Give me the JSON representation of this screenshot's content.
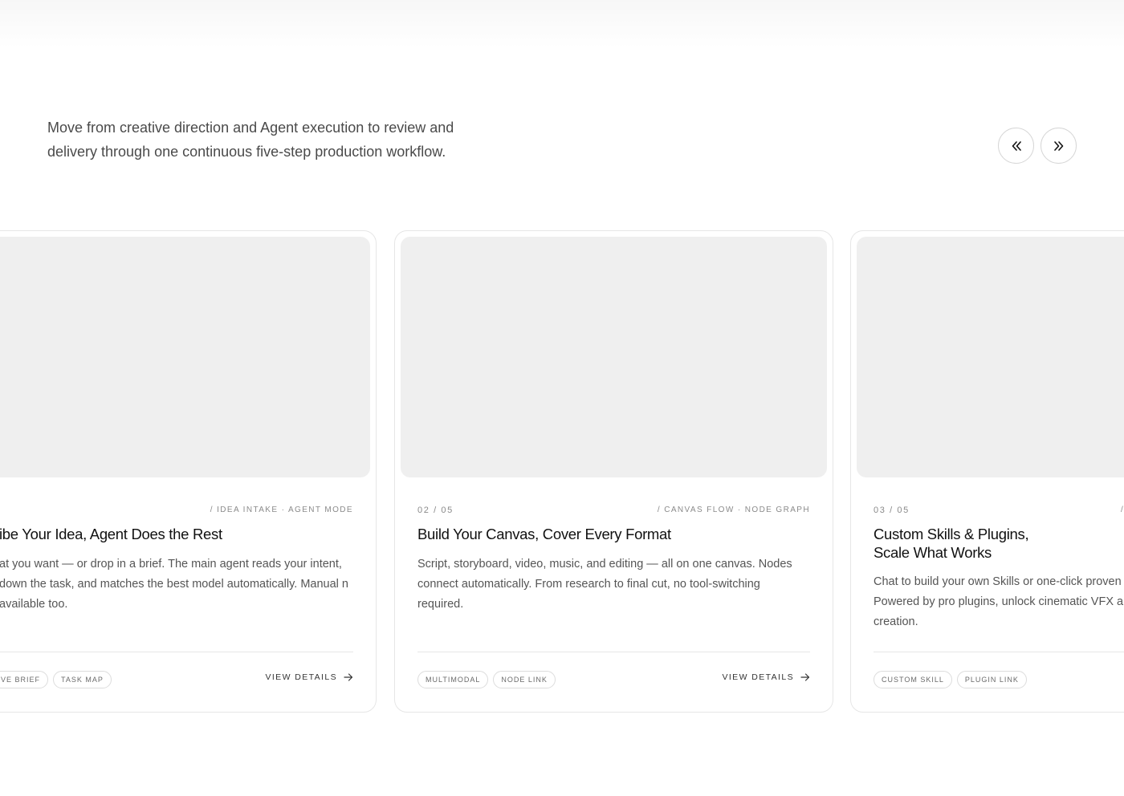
{
  "intro": {
    "text": "Move from creative direction and Agent execution to review and delivery through one continuous five-step production workflow."
  },
  "nav": {
    "prev_icon": "double-chevron-left-icon",
    "next_icon": "double-chevron-right-icon"
  },
  "cards": [
    {
      "index": "",
      "tagline": "/ IDEA INTAKE · AGENT MODE",
      "title": "ibe Your Idea, Agent Does the Rest",
      "description": "at you want — or drop in a brief. The main agent reads your intent, down the task, and matches the best model automatically. Manual n available too.",
      "tags": [
        "VE BRIEF",
        "TASK MAP"
      ],
      "cta": "VIEW DETAILS"
    },
    {
      "index": "02 / 05",
      "tagline": "/ CANVAS FLOW · NODE GRAPH",
      "title": "Build Your Canvas, Cover Every Format",
      "description": "Script, storyboard, video, music, and editing — all on one canvas. Nodes connect automatically. From research to final cut, no tool-switching required.",
      "tags": [
        "MULTIMODAL",
        "NODE LINK"
      ],
      "cta": "VIEW DETAILS"
    },
    {
      "index": "03 / 05",
      "tagline": "/",
      "title": "Custom Skills & Plugins, Scale What Works",
      "description": "Chat to build your own Skills or one-click proven Powered by pro plugins, unlock cinematic VFX a creation.",
      "tags": [
        "CUSTOM SKILL",
        "PLUGIN LINK"
      ],
      "cta": ""
    }
  ],
  "colors": {
    "background": "#ffffff",
    "card_border": "#e6e6e6",
    "media_placeholder": "#efefef",
    "muted_text": "#8a8a8a",
    "body_text": "#555555"
  }
}
